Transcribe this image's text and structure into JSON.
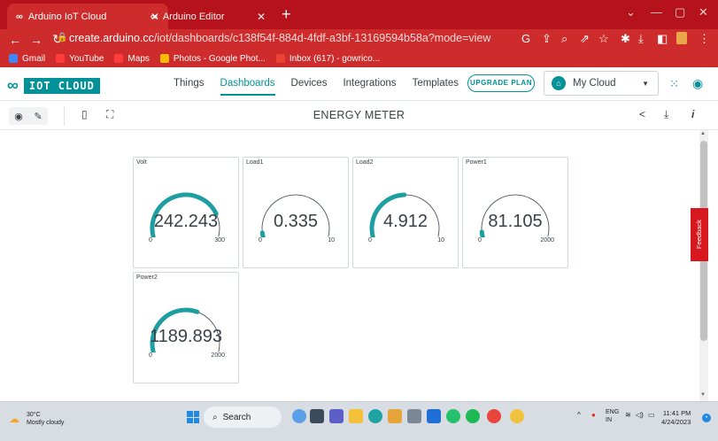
{
  "browser": {
    "tabs": [
      {
        "title": "Arduino IoT Cloud",
        "favicon": "arduino-icon"
      },
      {
        "title": "Arduino Editor",
        "favicon": "arduino-icon"
      }
    ],
    "new_tab": "+",
    "url_host": "create.arduino.cc",
    "url_path": "/iot/dashboards/c138f54f-884d-4fdf-a3bf-13169594b58a?mode=view",
    "bookmarks": [
      {
        "label": "Gmail",
        "color": "#4285f4"
      },
      {
        "label": "YouTube",
        "color": "#ff0000"
      },
      {
        "label": "Maps",
        "color": "#ff0000"
      },
      {
        "label": "Photos - Google Phot...",
        "color": "#fbbc05"
      },
      {
        "label": "Inbox (617) - gowrico...",
        "color": "#ea4335"
      }
    ]
  },
  "app": {
    "brand": "IOT CLOUD",
    "nav": [
      "Things",
      "Dashboards",
      "Devices",
      "Integrations",
      "Templates"
    ],
    "active_nav": "Dashboards",
    "upgrade_label": "UPGRADE PLAN",
    "cloud_label": "My Cloud",
    "accent": "#009199"
  },
  "dashboard": {
    "title": "ENERGY METER",
    "feedback_label": "Feedback",
    "widgets": [
      {
        "name": "Volt",
        "value": "242.243",
        "min": "0",
        "max": "300",
        "fraction": 0.807
      },
      {
        "name": "Load1",
        "value": "0.335",
        "min": "0",
        "max": "10",
        "fraction": 0.034
      },
      {
        "name": "Load2",
        "value": "4.912",
        "min": "0",
        "max": "10",
        "fraction": 0.491
      },
      {
        "name": "Power1",
        "value": "81.105",
        "min": "0",
        "max": "2000",
        "fraction": 0.041
      },
      {
        "name": "Power2",
        "value": "1189.893",
        "min": "0",
        "max": "2000",
        "fraction": 0.595
      }
    ]
  },
  "taskbar": {
    "temperature": "30°C",
    "condition": "Mostly cloudy",
    "search_label": "Search",
    "lang_top": "ENG",
    "lang_bottom": "IN",
    "time": "11:41 PM",
    "date": "4/24/2023"
  }
}
